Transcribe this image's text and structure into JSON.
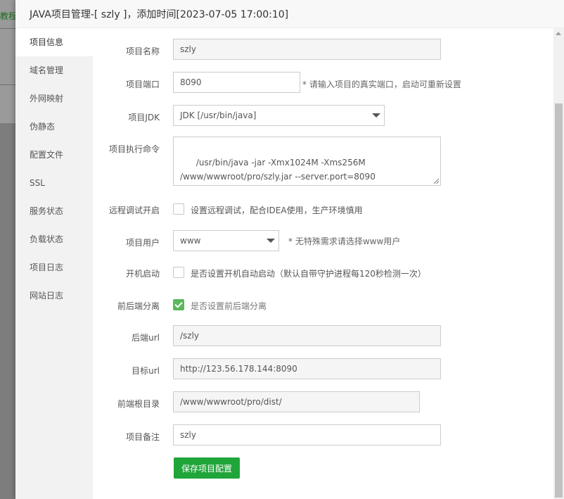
{
  "background": {
    "link_text": "教程"
  },
  "modal": {
    "title": "JAVA项目管理-[ szly ]，添加时间[2023-07-05 17:00:10]"
  },
  "sidebar": {
    "items": [
      {
        "label": "项目信息",
        "active": true
      },
      {
        "label": "域名管理"
      },
      {
        "label": "外网映射"
      },
      {
        "label": "伪静态"
      },
      {
        "label": "配置文件"
      },
      {
        "label": "SSL"
      },
      {
        "label": "服务状态"
      },
      {
        "label": "负载状态"
      },
      {
        "label": "项目日志"
      },
      {
        "label": "网站日志"
      }
    ]
  },
  "form": {
    "project_name": {
      "label": "项目名称",
      "value": "szly"
    },
    "project_port": {
      "label": "项目端口",
      "value": "8090",
      "hint": "* 请输入项目的真实端口，启动可重新设置"
    },
    "project_jdk": {
      "label": "项目JDK",
      "value": "JDK [/usr/bin/java]"
    },
    "exec_command": {
      "label": "项目执行命令",
      "value": "/usr/bin/java -jar -Xmx1024M -Xms256M\n/www/wwwroot/pro/szly.jar --server.port=8090"
    },
    "remote_debug": {
      "label": "远程调试开启",
      "checked": false,
      "text": "设置远程调试，配合IDEA使用，生产环境慎用"
    },
    "project_user": {
      "label": "项目用户",
      "value": "www",
      "hint": "* 无特殊需求请选择www用户"
    },
    "auto_start": {
      "label": "开机启动",
      "checked": false,
      "text": "是否设置开机自动启动（默认自带守护进程每120秒检测一次）"
    },
    "separation": {
      "label": "前后端分离",
      "checked": true,
      "text": "是否设置前后端分离"
    },
    "backend_url": {
      "label": "后端url",
      "value": "/szly"
    },
    "target_url": {
      "label": "目标url",
      "value": "http://123.56.178.144:8090"
    },
    "frontend_root": {
      "label": "前端根目录",
      "value": "/www/wwwroot/pro/dist/"
    },
    "remark": {
      "label": "项目备注",
      "value": "szly"
    },
    "save_label": "保存项目配置"
  },
  "colors": {
    "accent": "#20a53a",
    "checkbox_checked": "#5cb85c"
  }
}
